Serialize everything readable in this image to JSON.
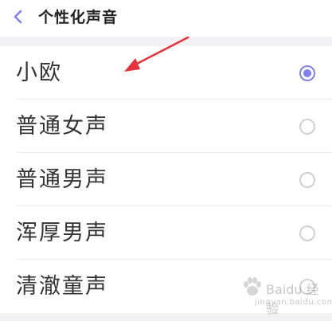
{
  "header": {
    "title": "个性化声音",
    "back_icon": "chevron-left-icon",
    "accent_color": "#7f82ee"
  },
  "voices": [
    {
      "label": "小欧",
      "selected": true
    },
    {
      "label": "普通女声",
      "selected": false
    },
    {
      "label": "普通男声",
      "selected": false
    },
    {
      "label": "浑厚男声",
      "selected": false
    },
    {
      "label": "清澈童声",
      "selected": false
    }
  ],
  "annotation": {
    "arrow_color": "#e8333a"
  },
  "watermark": {
    "brand": "Baidu 经验",
    "site": "jingyan.baidu.com"
  }
}
